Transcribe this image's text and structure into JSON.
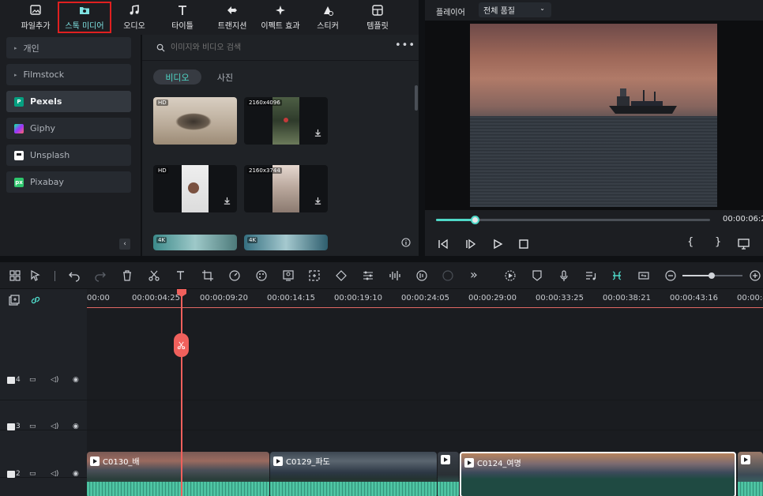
{
  "toolbar": {
    "items": [
      {
        "label": "파일추가",
        "icon": "import-icon"
      },
      {
        "label": "스톡 미디어",
        "icon": "stock-media-icon"
      },
      {
        "label": "오디오",
        "icon": "music-note-icon"
      },
      {
        "label": "타이틀",
        "icon": "title-t-icon"
      },
      {
        "label": "트랜지션",
        "icon": "transition-icon"
      },
      {
        "label": "이펙트 효과",
        "icon": "sparkle-icon"
      },
      {
        "label": "스티커",
        "icon": "sticker-icon"
      },
      {
        "label": "템플릿",
        "icon": "template-icon"
      }
    ]
  },
  "sidebar": {
    "items": [
      {
        "label": "개인",
        "type": "folder"
      },
      {
        "label": "Filmstock",
        "type": "folder"
      },
      {
        "label": "Pexels",
        "type": "source",
        "color": "#05a081"
      },
      {
        "label": "Giphy",
        "type": "source",
        "color": "#9b59f6"
      },
      {
        "label": "Unsplash",
        "type": "source",
        "color": "#ffffff"
      },
      {
        "label": "Pixabay",
        "type": "source",
        "color": "#2ec66d"
      }
    ]
  },
  "media": {
    "search_placeholder": "이미지와 비디오 검색",
    "tabs": [
      "비디오",
      "사진"
    ],
    "thumbs": [
      {
        "label": "HD"
      },
      {
        "label": "2160x4096"
      },
      {
        "label": "HD"
      },
      {
        "label": "2160x3744"
      },
      {
        "label": "4K"
      },
      {
        "label": "4K"
      }
    ]
  },
  "player": {
    "label": "플레이어",
    "quality": "전체 품질",
    "time": "00:00:06:2",
    "progress": 0.14
  },
  "timeline": {
    "ruler": [
      "00:00",
      "00:00:04:25",
      "00:00:09:20",
      "00:00:14:15",
      "00:00:19:10",
      "00:00:24:05",
      "00:00:29:00",
      "00:00:33:25",
      "00:00:38:21",
      "00:00:43:16",
      "00:00:4"
    ],
    "tracks": [
      {
        "number": "4"
      },
      {
        "number": "3"
      },
      {
        "number": "2"
      }
    ],
    "clips": [
      {
        "label": "C0130_배"
      },
      {
        "label": "C0129_파도"
      },
      {
        "label": ""
      },
      {
        "label": "C0124_여명"
      },
      {
        "label": ""
      }
    ]
  },
  "colors": {
    "accent": "#4fd8c8",
    "active_border": "#e02020",
    "playhead": "#f0605c"
  }
}
